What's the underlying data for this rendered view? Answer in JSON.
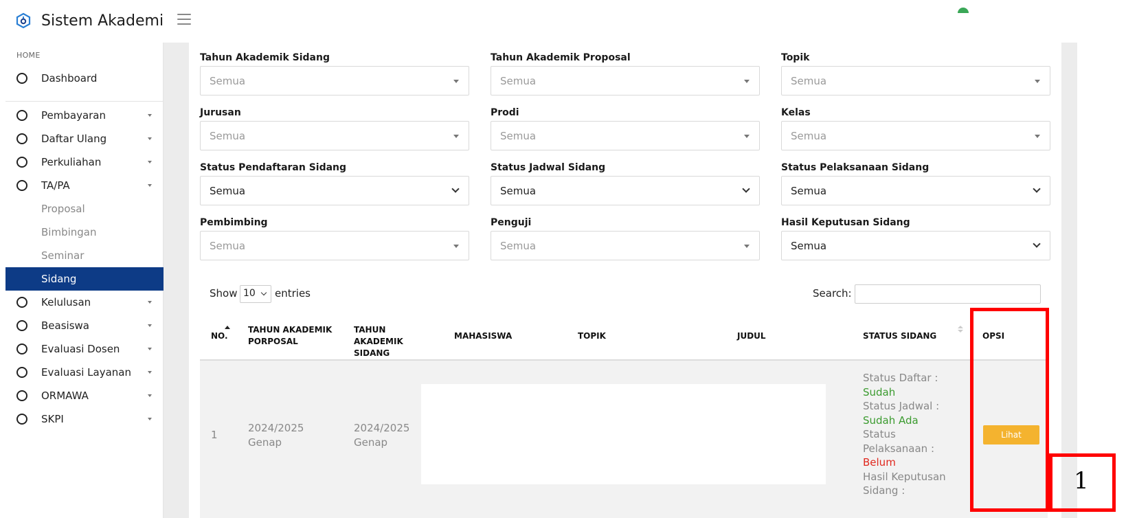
{
  "header": {
    "app_title": "Sistem Akademik"
  },
  "sidebar": {
    "section_head": "HOME",
    "items": [
      {
        "label": "Dashboard"
      },
      {
        "label": "Pembayaran"
      },
      {
        "label": "Daftar Ulang"
      },
      {
        "label": "Perkuliahan"
      },
      {
        "label": "TA/PA"
      },
      {
        "label": "Kelulusan"
      },
      {
        "label": "Beasiswa"
      },
      {
        "label": "Evaluasi Dosen"
      },
      {
        "label": "Evaluasi Layanan"
      },
      {
        "label": "ORMAWA"
      },
      {
        "label": "SKPI"
      }
    ],
    "sub_items": [
      {
        "label": "Proposal"
      },
      {
        "label": "Bimbingan"
      },
      {
        "label": "Seminar"
      },
      {
        "label": "Sidang"
      }
    ],
    "active_color": "#0d3b86"
  },
  "filters": [
    {
      "label": "Tahun Akademik Sidang",
      "value": "Semua"
    },
    {
      "label": "Tahun Akademik Proposal",
      "value": "Semua"
    },
    {
      "label": "Topik",
      "value": "Semua"
    },
    {
      "label": "Jurusan",
      "value": "Semua"
    },
    {
      "label": "Prodi",
      "value": "Semua"
    },
    {
      "label": "Kelas",
      "value": "Semua"
    },
    {
      "label": "Status Pendaftaran Sidang",
      "value": "Semua"
    },
    {
      "label": "Status Jadwal Sidang",
      "value": "Semua"
    },
    {
      "label": "Status Pelaksanaan Sidang",
      "value": "Semua"
    },
    {
      "label": "Pembimbing",
      "value": "Semua"
    },
    {
      "label": "Penguji",
      "value": "Semua"
    },
    {
      "label": "Hasil Keputusan Sidang",
      "value": "Semua"
    }
  ],
  "table_controls": {
    "show_label": "Show",
    "page_size": "10",
    "entries_label": "entries",
    "search_label": "Search:",
    "search_value": ""
  },
  "table": {
    "headers": {
      "no": "NO.",
      "tahun_proposal": "TAHUN AKADEMIK PORPOSAL",
      "tahun_sidang": "TAHUN AKADEMIK SIDANG",
      "mahasiswa": "MAHASISWA",
      "topik": "TOPIK",
      "judul": "JUDUL",
      "status": "STATUS SIDANG",
      "opsi": "OPSI"
    },
    "rows": [
      {
        "no": "1",
        "tahun_proposal": "2024/2025 Genap",
        "tahun_sidang": "2024/2025 Genap",
        "status_daftar_label": "Status Daftar :",
        "status_daftar": "Sudah",
        "status_jadwal_label": "Status Jadwal :",
        "status_jadwal": "Sudah Ada",
        "status_pelaksanaan_label": "Status Pelaksanaan :",
        "status_pelaksanaan": "Belum",
        "hasil_label": "Hasil Keputusan Sidang :",
        "action": "Lihat"
      }
    ]
  },
  "annotation": {
    "label": "1",
    "color": "#ff0000"
  },
  "colors": {
    "button": "#f4b32f",
    "success": "#3b9b2f",
    "danger": "#e0281e"
  }
}
